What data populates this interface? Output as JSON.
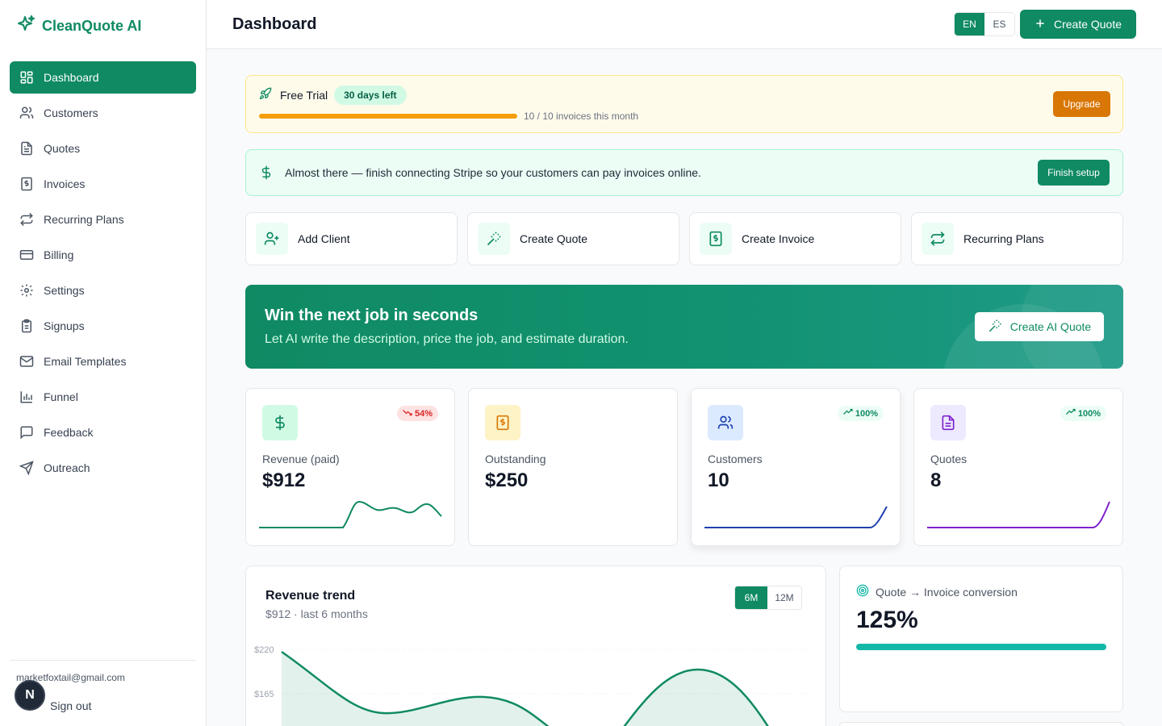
{
  "app": {
    "name": "CleanQuote AI"
  },
  "sidebar": {
    "items": [
      {
        "label": "Dashboard",
        "icon": "dashboard-icon",
        "active": true
      },
      {
        "label": "Customers",
        "icon": "users-icon"
      },
      {
        "label": "Quotes",
        "icon": "file-text-icon"
      },
      {
        "label": "Invoices",
        "icon": "invoice-icon"
      },
      {
        "label": "Recurring Plans",
        "icon": "repeat-icon"
      },
      {
        "label": "Billing",
        "icon": "credit-card-icon"
      },
      {
        "label": "Settings",
        "icon": "gear-icon"
      },
      {
        "label": "Signups",
        "icon": "clipboard-icon"
      },
      {
        "label": "Email Templates",
        "icon": "mail-icon"
      },
      {
        "label": "Funnel",
        "icon": "bar-chart-icon"
      },
      {
        "label": "Feedback",
        "icon": "message-icon"
      },
      {
        "label": "Outreach",
        "icon": "send-icon"
      }
    ],
    "user_email": "marketfoxtail@gmail.com",
    "avatar_letter": "N",
    "sign_out": "Sign out"
  },
  "header": {
    "title": "Dashboard",
    "languages": [
      "EN",
      "ES"
    ],
    "active_language": "EN",
    "create_quote": "Create Quote"
  },
  "trial": {
    "title": "Free Trial",
    "badge": "30 days left",
    "usage_text": "10 / 10 invoices this month",
    "usage_fraction": 1.0,
    "upgrade": "Upgrade"
  },
  "stripe_banner": {
    "text": "Almost there — finish connecting Stripe so your customers can pay invoices online.",
    "button": "Finish setup"
  },
  "quick_actions": [
    {
      "label": "Add Client",
      "icon": "user-plus-icon"
    },
    {
      "label": "Create Quote",
      "icon": "magic-wand-icon"
    },
    {
      "label": "Create Invoice",
      "icon": "invoice-icon"
    },
    {
      "label": "Recurring Plans",
      "icon": "repeat-icon"
    }
  ],
  "hero": {
    "title": "Win the next job in seconds",
    "subtitle": "Let AI write the description, price the job, and estimate duration.",
    "button": "Create AI Quote"
  },
  "kpis": [
    {
      "label": "Revenue (paid)",
      "value": "$912",
      "badge": "54%",
      "trend": "down",
      "icon": "dollar-icon",
      "color": "#0f8a63"
    },
    {
      "label": "Outstanding",
      "value": "$250",
      "badge": "",
      "trend": "",
      "icon": "invoice-icon",
      "color": "#d97706"
    },
    {
      "label": "Customers",
      "value": "10",
      "badge": "100%",
      "trend": "up",
      "icon": "users-icon",
      "color": "#1e40af"
    },
    {
      "label": "Quotes",
      "value": "8",
      "badge": "100%",
      "trend": "up",
      "icon": "file-text-icon",
      "color": "#7e22ce"
    }
  ],
  "revenue_trend": {
    "title": "Revenue trend",
    "subtitle": "$912 · last 6 months",
    "ranges": [
      "6M",
      "12M"
    ],
    "active_range": "6M",
    "y_ticks": [
      "$220",
      "$165"
    ]
  },
  "conversion": {
    "label": "Quote → Invoice conversion",
    "value": "125%",
    "fraction": 1.0
  },
  "colors": {
    "brand": "#0f8a63",
    "trial_bg": "#fffbeb",
    "upgrade": "#d97706",
    "teal": "#14b8a6"
  }
}
